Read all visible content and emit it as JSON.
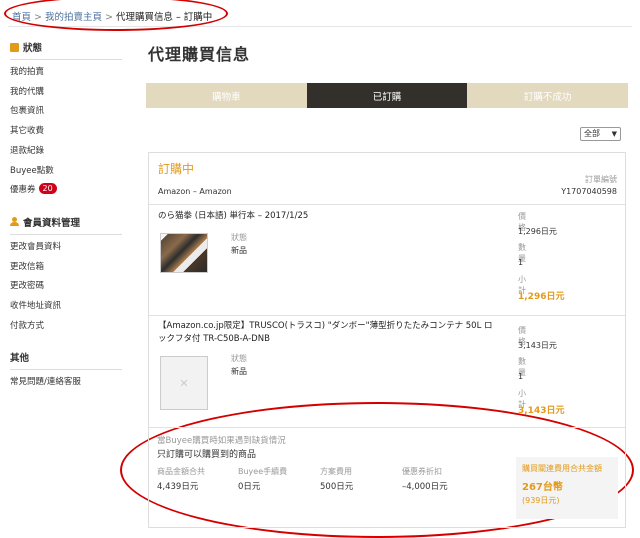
{
  "breadcrumb": {
    "home": "首頁",
    "mypage": "我的拍賣主頁",
    "current": "代理購買信息 – 訂購中",
    "separator": ">"
  },
  "sidebar": {
    "group1": {
      "heading": "狀態",
      "items": [
        "我的拍賣",
        "我的代購",
        "包裹資訊",
        "其它收費",
        "退款紀錄",
        "Buyee點數",
        "優惠券"
      ],
      "coupon_badge": "20"
    },
    "group2": {
      "heading": "會員資料管理",
      "items": [
        "更改會員資料",
        "更改信箱",
        "更改密碼",
        "收件地址資訊",
        "付款方式"
      ]
    },
    "group3": {
      "heading": "其他",
      "items": [
        "常見問題/連絡客服"
      ]
    }
  },
  "page": {
    "title": "代理購買信息"
  },
  "tabs": [
    {
      "label": "購物車",
      "active": false
    },
    {
      "label": "已訂購",
      "active": true
    },
    {
      "label": "訂購不成功",
      "active": false
    }
  ],
  "filter": {
    "selected": "全部"
  },
  "order": {
    "status": "訂購中",
    "store": "Amazon – Amazon",
    "order_no_label": "訂單編號",
    "order_no": "Y1707040598",
    "items": [
      {
        "title": "のら猫拳 (日本語) 単行本 – 2017/1/25",
        "status_label": "狀態",
        "status_value": "新品",
        "price_label": "價格",
        "price": "1,296日元",
        "qty_label": "數量",
        "qty": "1",
        "subtotal_label": "小計",
        "subtotal": "1,296日元"
      },
      {
        "title_line1": "【Amazon.co.jp限定】TRUSCO(トラスコ) \"ダンボー\"薄型折りたたみコンテナ 50L ロ",
        "title_line2": "ックフタ付 TR-C50B-A-DNB",
        "status_label": "狀態",
        "status_value": "新品",
        "price_label": "價格",
        "price": "3,143日元",
        "qty_label": "數量",
        "qty": "1",
        "subtotal_label": "小計",
        "subtotal": "3,143日元"
      }
    ],
    "note_label": "當Buyee購買時如果遇到缺貨情況",
    "note_value": "只訂購可以購買到的商品",
    "summary": {
      "goods_label": "商品金額合共",
      "goods": "4,439日元",
      "fee_label": "Buyee手續費",
      "fee": "0日元",
      "plan_label": "方案費用",
      "plan": "500日元",
      "coupon_label": "優惠券折扣",
      "coupon": "–4,000日元"
    },
    "total": {
      "label": "購買關連費用合共金額",
      "twd": "267台幣",
      "jpy": "(939日元)"
    }
  },
  "colors": {
    "accent": "#e29a1a",
    "tab_bg": "#e3d9bf",
    "tab_active": "#33302b",
    "badge": "#d0021b",
    "annotation": "#d40000"
  }
}
